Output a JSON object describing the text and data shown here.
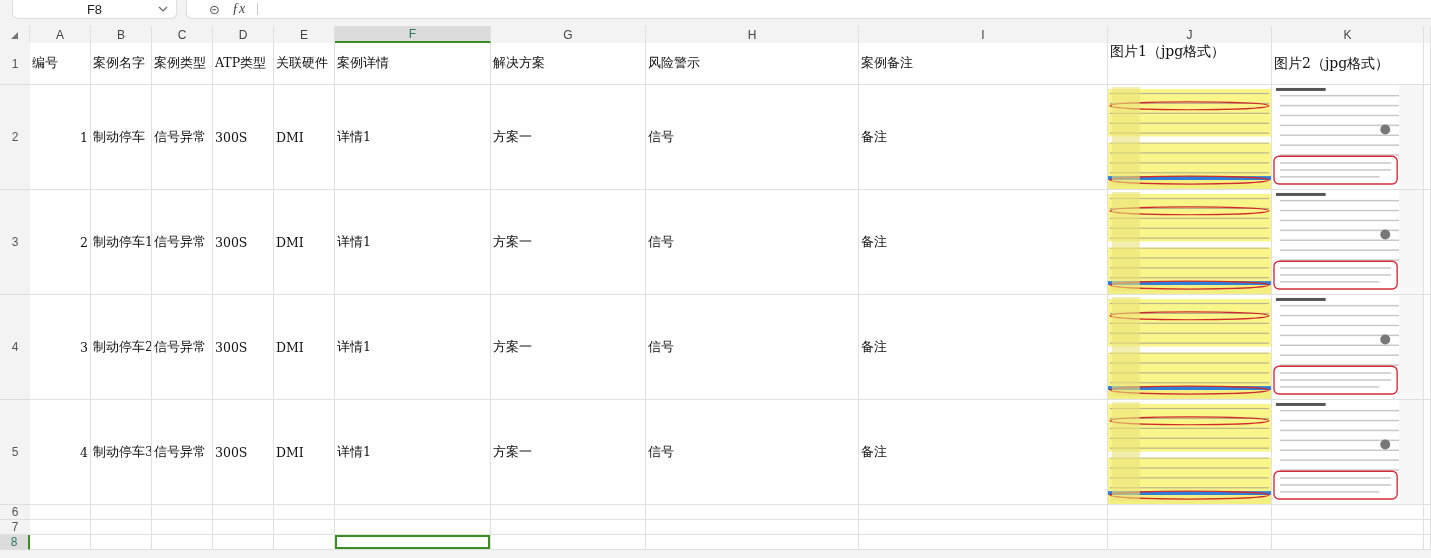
{
  "name_box": {
    "value": "F8"
  },
  "formula_bar": {
    "zoom_glyph": "⊝",
    "fx": "ƒx"
  },
  "columns": [
    {
      "label": "A",
      "selected": false
    },
    {
      "label": "B",
      "selected": false
    },
    {
      "label": "C",
      "selected": false
    },
    {
      "label": "D",
      "selected": false
    },
    {
      "label": "E",
      "selected": false
    },
    {
      "label": "F",
      "selected": true
    },
    {
      "label": "G",
      "selected": false
    },
    {
      "label": "H",
      "selected": false
    },
    {
      "label": "I",
      "selected": false
    },
    {
      "label": "J",
      "selected": false
    },
    {
      "label": "K",
      "selected": false
    }
  ],
  "rows": [
    {
      "label": "1",
      "selected": false,
      "cells": [
        "编号",
        "案例名字",
        "案例类型",
        "ATP类型",
        "关联硬件",
        "案例详情",
        "解决方案",
        "风险警示",
        "案例备注",
        "图片1（jpg格式）",
        "图片2（jpg格式）"
      ]
    },
    {
      "label": "2",
      "selected": false,
      "cells": [
        "1",
        "制动停车",
        "信号异常",
        "300S",
        "DMI",
        "详情1",
        "方案一",
        "信号",
        "备注",
        {
          "kind": "picture"
        },
        {
          "kind": "picture"
        }
      ]
    },
    {
      "label": "3",
      "selected": false,
      "cells": [
        "2",
        "制动停车1",
        "信号异常",
        "300S",
        "DMI",
        "详情1",
        "方案一",
        "信号",
        "备注",
        {
          "kind": "picture"
        },
        {
          "kind": "picture"
        }
      ]
    },
    {
      "label": "4",
      "selected": false,
      "cells": [
        "3",
        "制动停车2",
        "信号异常",
        "300S",
        "DMI",
        "详情1",
        "方案一",
        "信号",
        "备注",
        {
          "kind": "picture"
        },
        {
          "kind": "picture"
        }
      ]
    },
    {
      "label": "5",
      "selected": false,
      "cells": [
        "4",
        "制动停车3",
        "信号异常",
        "300S",
        "DMI",
        "详情1",
        "方案一",
        "信号",
        "备注",
        {
          "kind": "picture"
        },
        {
          "kind": "picture"
        }
      ]
    },
    {
      "label": "6",
      "selected": false,
      "cells": []
    },
    {
      "label": "7",
      "selected": false,
      "cells": []
    },
    {
      "label": "8",
      "selected": true,
      "cells": []
    }
  ]
}
